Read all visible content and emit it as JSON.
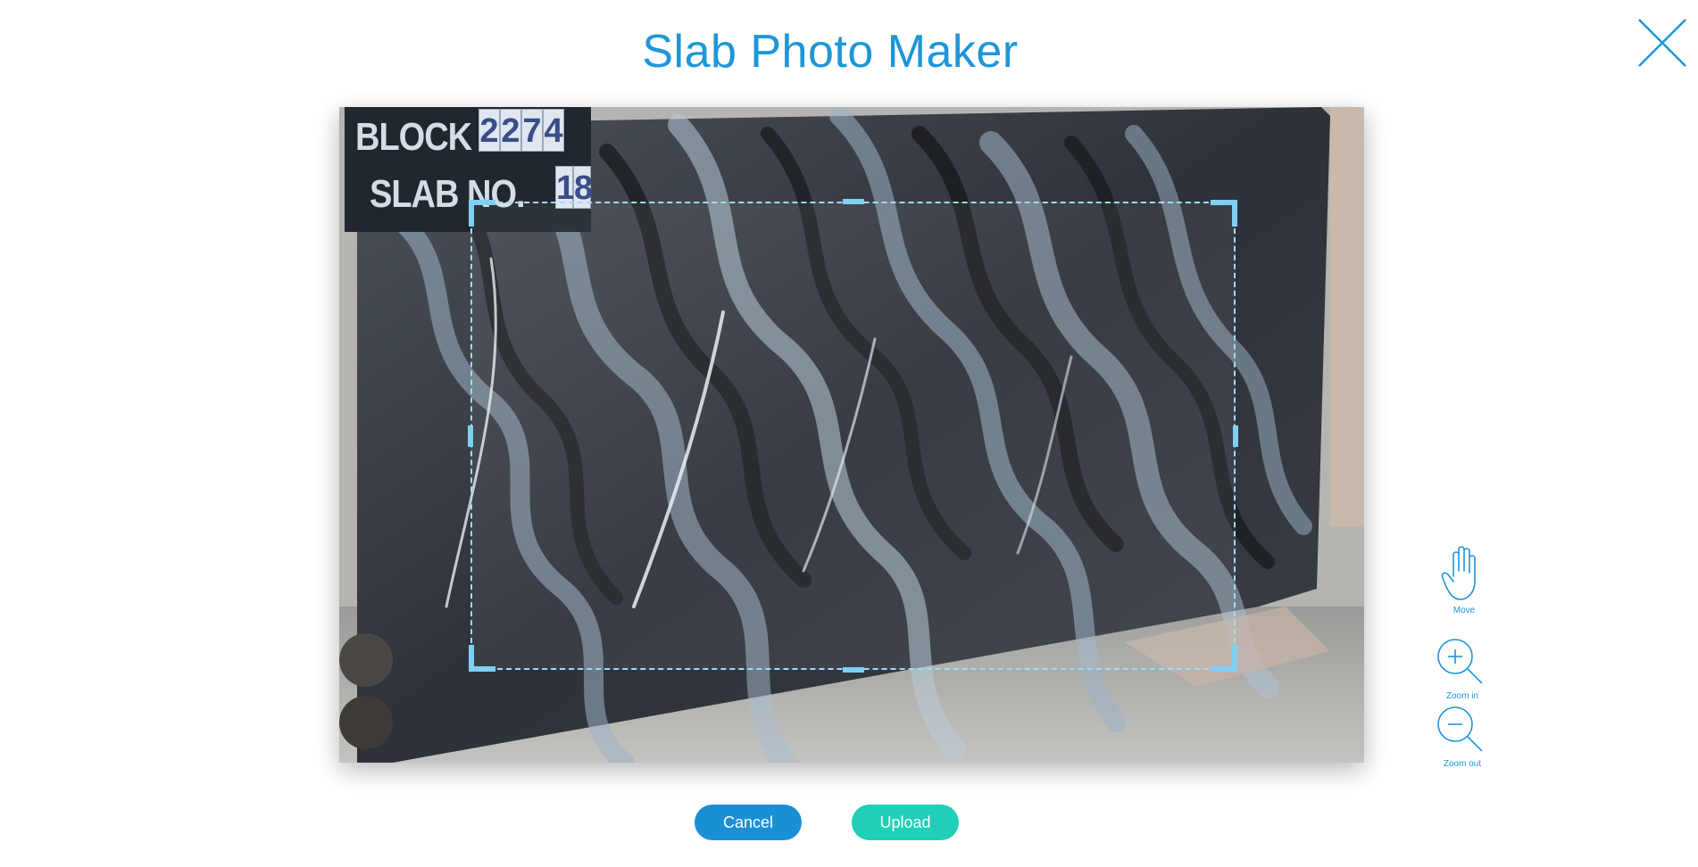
{
  "header": {
    "title": "Slab Photo Maker"
  },
  "photo": {
    "sign": {
      "block_label": "BLOCK NO.",
      "block_digits": [
        "2",
        "2",
        "7",
        "4"
      ],
      "slab_label": "SLAB NO.",
      "slab_digits": [
        "1",
        "8"
      ]
    }
  },
  "tools": {
    "move_label": "Move",
    "zoom_in_label": "Zoom in",
    "zoom_out_label": "Zoom out"
  },
  "actions": {
    "cancel_label": "Cancel",
    "upload_label": "Upload"
  },
  "colors": {
    "accent": "#1e96d8",
    "cancel": "#1b8fd6",
    "upload": "#1fcfb8",
    "crop_border": "#9fdcf6"
  }
}
